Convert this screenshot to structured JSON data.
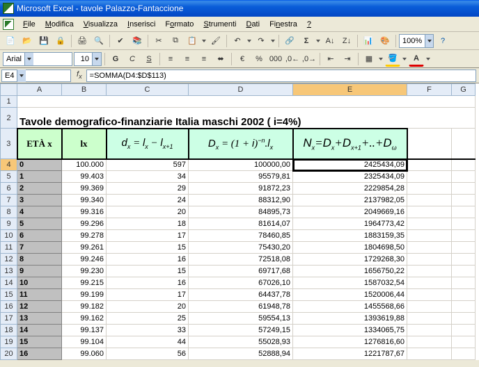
{
  "title": "Microsoft Excel - tavole Palazzo-Fantaccione",
  "menus": [
    "File",
    "Modifica",
    "Visualizza",
    "Inserisci",
    "Formato",
    "Strumenti",
    "Dati",
    "Finestra",
    "?"
  ],
  "font": "Arial",
  "fontsize": "10",
  "zoom": "100%",
  "namebox": "E4",
  "formula": "=SOMMA(D4:$D$113)",
  "colheads": [
    "A",
    "B",
    "C",
    "D",
    "E",
    "F",
    "G"
  ],
  "doc_title": "Tavole demografico-finanziarie  Italia maschi 2002 ( i=4%)",
  "hdr": {
    "a": "ETÀ  x",
    "b": "lx"
  },
  "rows": [
    {
      "n": 4,
      "age": "0",
      "lx": "100.000",
      "dx": "597",
      "Dx": "100000,00",
      "Nx": "2425434,09"
    },
    {
      "n": 5,
      "age": "1",
      "lx": "99.403",
      "dx": "34",
      "Dx": "95579,81",
      "Nx": "2325434,09"
    },
    {
      "n": 6,
      "age": "2",
      "lx": "99.369",
      "dx": "29",
      "Dx": "91872,23",
      "Nx": "2229854,28"
    },
    {
      "n": 7,
      "age": "3",
      "lx": "99.340",
      "dx": "24",
      "Dx": "88312,90",
      "Nx": "2137982,05"
    },
    {
      "n": 8,
      "age": "4",
      "lx": "99.316",
      "dx": "20",
      "Dx": "84895,73",
      "Nx": "2049669,16"
    },
    {
      "n": 9,
      "age": "5",
      "lx": "99.296",
      "dx": "18",
      "Dx": "81614,07",
      "Nx": "1964773,42"
    },
    {
      "n": 10,
      "age": "6",
      "lx": "99.278",
      "dx": "17",
      "Dx": "78460,85",
      "Nx": "1883159,35"
    },
    {
      "n": 11,
      "age": "7",
      "lx": "99.261",
      "dx": "15",
      "Dx": "75430,20",
      "Nx": "1804698,50"
    },
    {
      "n": 12,
      "age": "8",
      "lx": "99.246",
      "dx": "16",
      "Dx": "72518,08",
      "Nx": "1729268,30"
    },
    {
      "n": 13,
      "age": "9",
      "lx": "99.230",
      "dx": "15",
      "Dx": "69717,68",
      "Nx": "1656750,22"
    },
    {
      "n": 14,
      "age": "10",
      "lx": "99.215",
      "dx": "16",
      "Dx": "67026,10",
      "Nx": "1587032,54"
    },
    {
      "n": 15,
      "age": "11",
      "lx": "99.199",
      "dx": "17",
      "Dx": "64437,78",
      "Nx": "1520006,44"
    },
    {
      "n": 16,
      "age": "12",
      "lx": "99.182",
      "dx": "20",
      "Dx": "61948,78",
      "Nx": "1455568,66"
    },
    {
      "n": 17,
      "age": "13",
      "lx": "99.162",
      "dx": "25",
      "Dx": "59554,13",
      "Nx": "1393619,88"
    },
    {
      "n": 18,
      "age": "14",
      "lx": "99.137",
      "dx": "33",
      "Dx": "57249,15",
      "Nx": "1334065,75"
    },
    {
      "n": 19,
      "age": "15",
      "lx": "99.104",
      "dx": "44",
      "Dx": "55028,93",
      "Nx": "1276816,60"
    },
    {
      "n": 20,
      "age": "16",
      "lx": "99.060",
      "dx": "56",
      "Dx": "52888,94",
      "Nx": "1221787,67"
    }
  ],
  "chart_data": {
    "type": "table",
    "title": "Tavole demografico-finanziarie Italia maschi 2002 (i=4%)",
    "columns": [
      "ETÀ x",
      "lx",
      "d_x = l_x - l_{x+1}",
      "D_x = (1+i)^{-n} · l_x",
      "N_x = D_x + D_{x+1} + … + D_ω"
    ],
    "x": [
      0,
      1,
      2,
      3,
      4,
      5,
      6,
      7,
      8,
      9,
      10,
      11,
      12,
      13,
      14,
      15,
      16
    ],
    "series": [
      {
        "name": "lx",
        "values": [
          100000,
          99403,
          99369,
          99340,
          99316,
          99296,
          99278,
          99261,
          99246,
          99230,
          99215,
          99199,
          99182,
          99162,
          99137,
          99104,
          99060
        ]
      },
      {
        "name": "d_x",
        "values": [
          597,
          34,
          29,
          24,
          20,
          18,
          17,
          15,
          16,
          15,
          16,
          17,
          20,
          25,
          33,
          44,
          56
        ]
      },
      {
        "name": "D_x",
        "values": [
          100000.0,
          95579.81,
          91872.23,
          88312.9,
          84895.73,
          81614.07,
          78460.85,
          75430.2,
          72518.08,
          69717.68,
          67026.1,
          64437.78,
          61948.78,
          59554.13,
          57249.15,
          55028.93,
          52888.94
        ]
      },
      {
        "name": "N_x",
        "values": [
          2425434.09,
          2325434.09,
          2229854.28,
          2137982.05,
          2049669.16,
          1964773.42,
          1883159.35,
          1804698.5,
          1729268.3,
          1656750.22,
          1587032.54,
          1520006.44,
          1455568.66,
          1393619.88,
          1334065.75,
          1276816.6,
          1221787.67
        ]
      }
    ]
  }
}
